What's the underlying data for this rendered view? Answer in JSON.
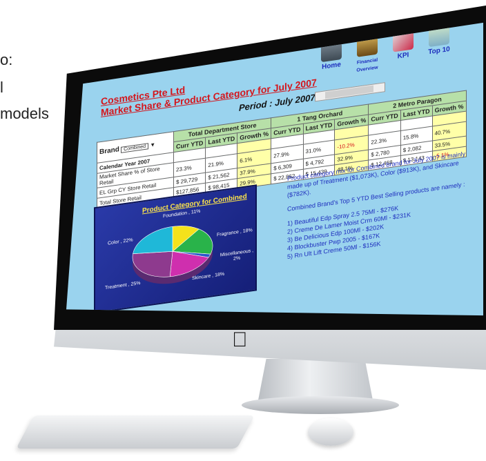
{
  "background_caption": [
    "o:",
    "l",
    "models"
  ],
  "nav": [
    {
      "label": "Home",
      "icon": "home-icon"
    },
    {
      "label": "Financial Overview",
      "icon": "financial-overview-icon"
    },
    {
      "label": "KPI",
      "icon": "kpi-icon"
    },
    {
      "label": "Top 10",
      "icon": "top10-icon"
    }
  ],
  "report": {
    "company": "Cosmetics Pte Ltd",
    "title": "Market Share & Product Category for July 2007",
    "period_label": "Period : July 2007"
  },
  "table": {
    "brand_label": "Brand",
    "brand_value": "Combined",
    "groups": [
      {
        "code": "",
        "name": "Total Department Store"
      },
      {
        "code": "1",
        "name": "Tang Orchard"
      },
      {
        "code": "2",
        "name": "Metro Paragon"
      }
    ],
    "col_headers": [
      "Curr YTD",
      "Last YTD",
      "Growth %"
    ],
    "rows": [
      {
        "label": "Calendar Year 2007",
        "values": [
          "",
          "",
          "",
          "",
          "",
          "",
          "",
          "",
          ""
        ]
      },
      {
        "label": "Market Share % of Store Retail",
        "values": [
          "23.3%",
          "21.9%",
          "6.1%",
          "27.9%",
          "31.0%",
          "-10.2%",
          "22.3%",
          "15.8%",
          "40.7%"
        ]
      },
      {
        "label": "EL Grp CY Store Retail",
        "values": [
          "$ 29,729",
          "$ 21,562",
          "37.9%",
          "$ 6,309",
          "$ 4,792",
          "32.9%",
          "$ 2,780",
          "$ 2,082",
          "33.5%"
        ]
      },
      {
        "label": "Total Store Retail",
        "values": [
          "$127,856",
          "$ 98,415",
          "29.9%",
          "$ 22,862",
          "$ 15,439",
          "48.1%",
          "$ 12,468",
          "$ 13,143",
          "-5.1%"
        ]
      }
    ]
  },
  "pie": {
    "title": "Product Category for Combined",
    "slices": [
      {
        "label": "Foundation , 11%",
        "value": 11,
        "color": "#f4e21b"
      },
      {
        "label": "Fragrance , 18%",
        "value": 18,
        "color": "#29b34a"
      },
      {
        "label": "Miscellaneous , 2%",
        "value": 2,
        "color": "#2b56c9"
      },
      {
        "label": "Skincare , 18%",
        "value": 18,
        "color": "#cf2fae"
      },
      {
        "label": "Treatment , 25%",
        "value": 25,
        "color": "#8e3a8e"
      },
      {
        "label": "Color , 22%",
        "value": 22,
        "color": "#1fb8d8"
      }
    ]
  },
  "notes": {
    "summary": "Product category mix for Combined brand for July 2007 is mainly made up of Treatment ($1,073K), Color ($913K), and Skincare ($782K).",
    "top5_intro": "Combined Brand's Top 5 YTD Best Selling products are namely :",
    "top5": [
      "1) Beautiful Edp Spray 2.5 75Ml - $276K",
      "2) Creme De Lamer Moist Crm 60Ml - $231K",
      "3) Be Delicious Edp 100Ml - $202K",
      "4) Blockbuster Pwp 2005 - $167K",
      "5) Rn Ult Lift Creme 50Ml - $156K"
    ]
  }
}
